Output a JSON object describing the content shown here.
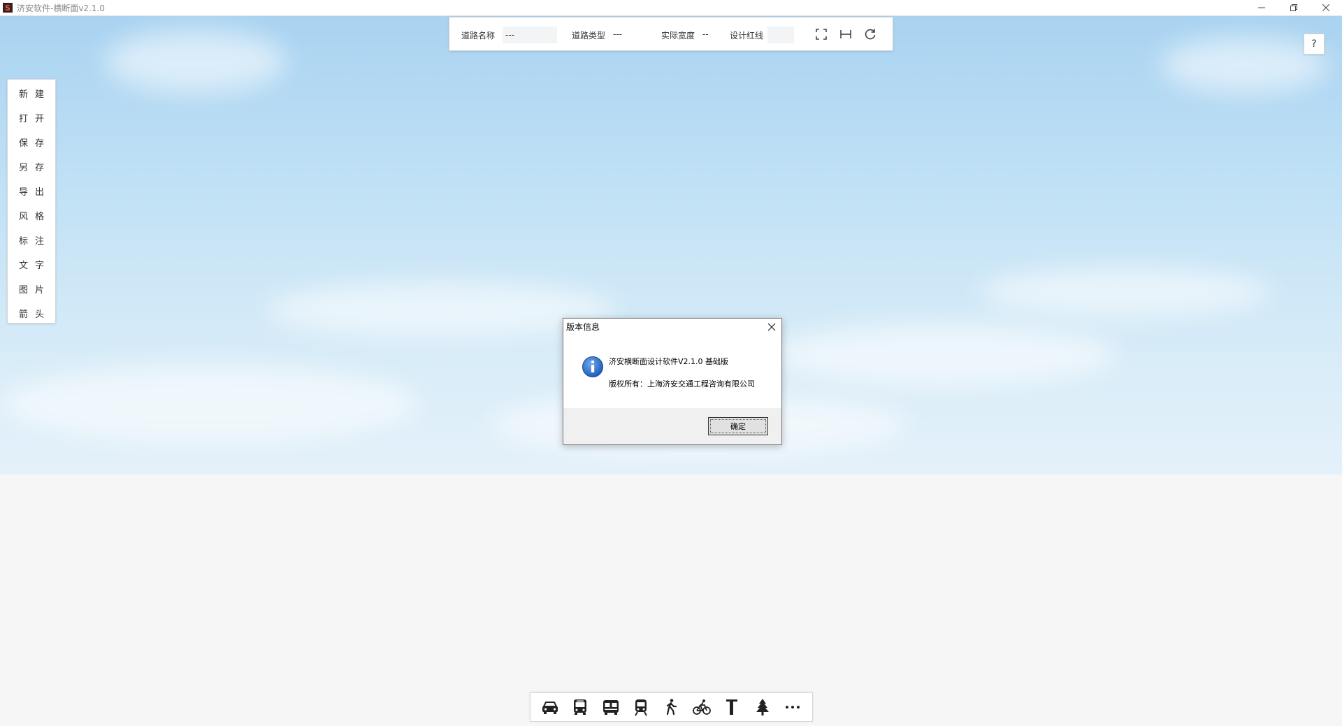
{
  "window": {
    "title": "济安软件-横断面v2.1.0",
    "logo_text": "S"
  },
  "infobar": {
    "road_name_label": "道路名称",
    "road_name_value": "---",
    "road_type_label": "道路类型",
    "road_type_value": "---",
    "actual_width_label": "实际宽度",
    "actual_width_value": "--",
    "red_line_label": "设计红线",
    "red_line_value": ""
  },
  "help": {
    "label": "?"
  },
  "side_menu": {
    "items": [
      "新建",
      "打开",
      "保存",
      "另存",
      "导出",
      "风格",
      "标注",
      "文字",
      "图片",
      "箭头"
    ]
  },
  "dialog": {
    "title": "版本信息",
    "line1": "济安横断面设计软件V2.1.0 基础版",
    "line2": "版权所有：上海济安交通工程咨询有限公司",
    "ok_label": "确定"
  },
  "bottom_tools": [
    "car-icon",
    "bus-icon",
    "tram-icon",
    "train-icon",
    "pedestrian-icon",
    "bicycle-icon",
    "pole-icon",
    "tree-icon",
    "more-icon"
  ],
  "colors": {
    "sky_top": "#a9d3f1",
    "info_blue": "#1f5fb8"
  }
}
